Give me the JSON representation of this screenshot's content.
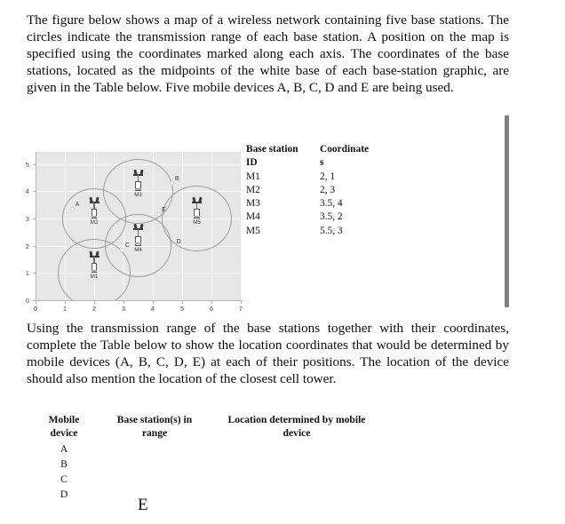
{
  "intro_paragraph": "The figure below shows a map of a wireless network containing five base stations. The circles indicate the transmission range of each base station. A position on the map is specified using the coordinates marked along each axis. The coordinates of the base stations, located as the midpoints of the white base of each base-station graphic, are given in the Table below. Five mobile devices A, B, C, D and E are being used.",
  "task_paragraph": "Using the transmission range of the base stations together with their coordinates, complete the Table below to show the location coordinates that would be determined by mobile devices (A, B, C, D, E) at each of their positions. The location of the device should also mention the location of the closest cell tower.",
  "base_station_table": {
    "header_col1_line1": "Base station",
    "header_col1_line2": "ID",
    "header_col2_line1": "Coordinate",
    "header_col2_line2": "s",
    "rows": [
      {
        "id": "M1",
        "coordinates": "2, 1"
      },
      {
        "id": "M2",
        "coordinates": "2, 3"
      },
      {
        "id": "M3",
        "coordinates": "3.5, 4"
      },
      {
        "id": "M4",
        "coordinates": "3.5, 2"
      },
      {
        "id": "M5",
        "coordinates": "5.5, 3"
      }
    ]
  },
  "answer_table": {
    "header_col1_line1": "Mobile",
    "header_col1_line2": "device",
    "header_col2_line1": "Base station(s) in",
    "header_col2_line2": "range",
    "header_col3_line1": "Location determined by mobile",
    "header_col3_line2": "device",
    "rows": [
      {
        "device": "A",
        "stations_in_range": "",
        "location": ""
      },
      {
        "device": "B",
        "stations_in_range": "",
        "location": ""
      },
      {
        "device": "C",
        "stations_in_range": "",
        "location": ""
      },
      {
        "device": "D",
        "stations_in_range": "",
        "location": ""
      }
    ],
    "trailing_device": "E"
  },
  "chart_data": {
    "type": "scatter",
    "title": "",
    "xlabel": "",
    "ylabel": "",
    "xlim": [
      0,
      7
    ],
    "ylim": [
      0,
      5.45
    ],
    "xticks": [
      "0",
      "1",
      "2",
      "3",
      "4",
      "5",
      "6",
      "7"
    ],
    "yticks": [
      "0",
      "1",
      "2",
      "3",
      "4",
      "5"
    ],
    "grid": true,
    "plot_background": "#e7e7e7",
    "gridline_color": "#fbfbfb",
    "circle_color": "#9d9d9d",
    "base_stations": [
      {
        "id": "M1",
        "x": 2,
        "y": 1,
        "range": 1.25
      },
      {
        "id": "M2",
        "x": 2,
        "y": 3,
        "range": 1.1
      },
      {
        "id": "M3",
        "x": 3.5,
        "y": 4,
        "range": 1.2
      },
      {
        "id": "M4",
        "x": 3.5,
        "y": 2,
        "range": 1.15
      },
      {
        "id": "M5",
        "x": 5.5,
        "y": 3,
        "range": 1.2
      }
    ],
    "mobile_devices": [
      {
        "id": "A",
        "x": 1.25,
        "y": 3.35
      },
      {
        "id": "B",
        "x": 4.65,
        "y": 4.3
      },
      {
        "id": "C",
        "x": 2.95,
        "y": 1.85
      },
      {
        "id": "D",
        "x": 4.7,
        "y": 2.0
      },
      {
        "id": "E",
        "x": 4.2,
        "y": 3.15
      }
    ]
  }
}
